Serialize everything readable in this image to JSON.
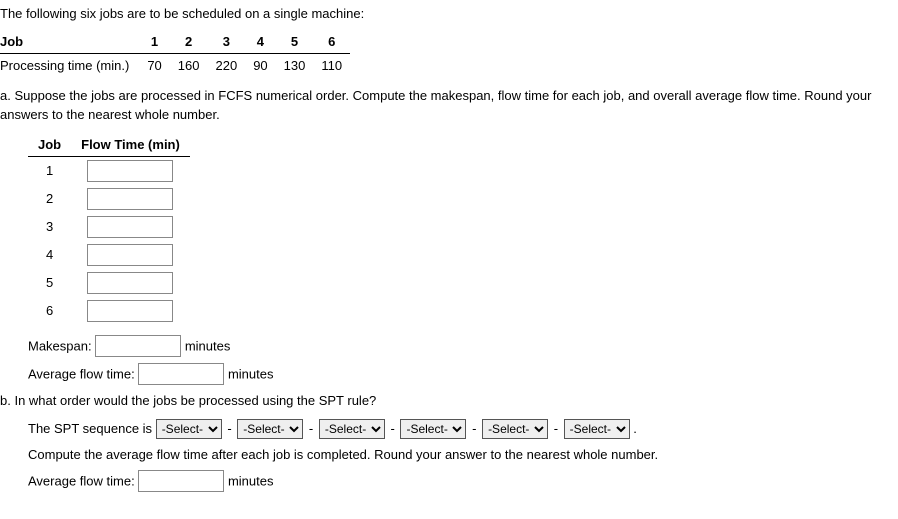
{
  "intro": "The following six jobs are to be scheduled on a single machine:",
  "jobsTable": {
    "rowHeaders": {
      "job": "Job",
      "proc": "Processing time (min.)"
    },
    "jobs": [
      "1",
      "2",
      "3",
      "4",
      "5",
      "6"
    ],
    "times": [
      "70",
      "160",
      "220",
      "90",
      "130",
      "110"
    ]
  },
  "partA": {
    "label": "a.",
    "text": "Suppose the jobs are processed in FCFS numerical order. Compute the makespan, flow time for each job, and overall average flow time. Round your answers to the nearest whole number."
  },
  "flowTable": {
    "headJob": "Job",
    "headFlow": "Flow Time (min)",
    "rows": [
      "1",
      "2",
      "3",
      "4",
      "5",
      "6"
    ]
  },
  "makespan": {
    "label": "Makespan:",
    "unit": "minutes"
  },
  "avgFlowA": {
    "label": "Average flow time:",
    "unit": "minutes"
  },
  "partB": {
    "label": "b.",
    "text": "In what order would the jobs be processed using the SPT rule?"
  },
  "sptLine": {
    "prefix": "The SPT sequence is",
    "placeholder": "-Select-",
    "dash": "-",
    "period": "."
  },
  "computeLine": "Compute the average flow time after each job is completed. Round your answer to the nearest whole number.",
  "avgFlowB": {
    "label": "Average flow time:",
    "unit": "minutes"
  }
}
